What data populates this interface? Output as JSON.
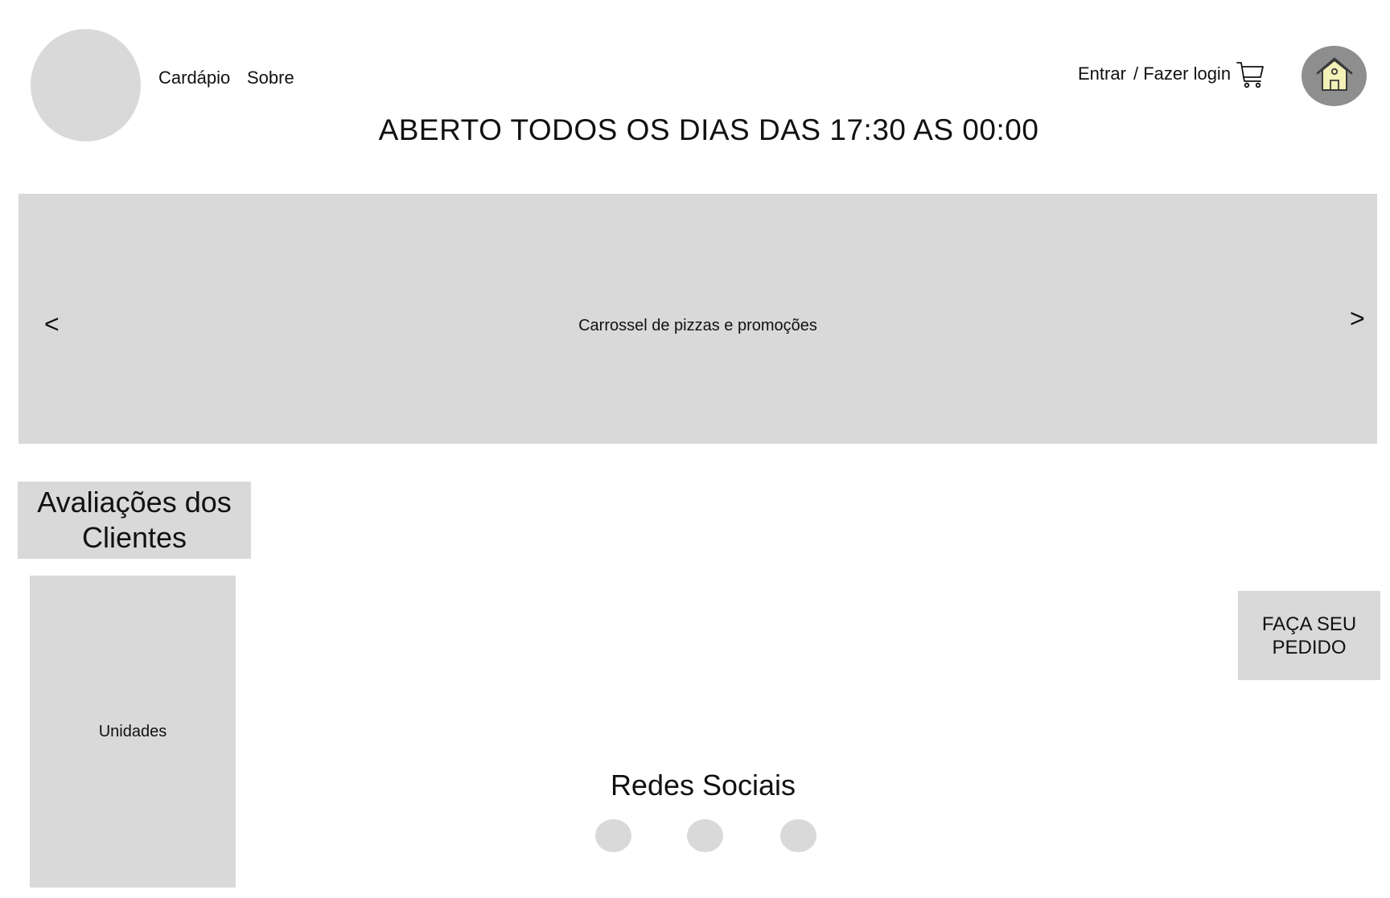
{
  "header": {
    "nav": {
      "menu_label": "Cardápio",
      "about_label": "Sobre"
    },
    "login": {
      "enter_label": "Entrar",
      "login_label": "/ Fazer login"
    },
    "icons": {
      "cart": "cart-icon",
      "home": "home-icon"
    }
  },
  "hours_banner": {
    "text": "ABERTO TODOS OS DIAS DAS 17:30 AS 00:00"
  },
  "carousel": {
    "label": "Carrossel de pizzas e promoções",
    "prev_label": "<",
    "next_label": ">"
  },
  "reviews": {
    "title": "Avaliações dos Clientes"
  },
  "units": {
    "label": "Unidades"
  },
  "order": {
    "label": "FAÇA SEU PEDIDO"
  },
  "social": {
    "title": "Redes Sociais",
    "links": [
      "social-link-1",
      "social-link-2",
      "social-link-3"
    ]
  },
  "colors": {
    "placeholder_gray": "#d9d9d9",
    "home_button_gray": "#8e8e8e",
    "home_icon_fill": "#f3f1b8",
    "text": "#111111"
  }
}
